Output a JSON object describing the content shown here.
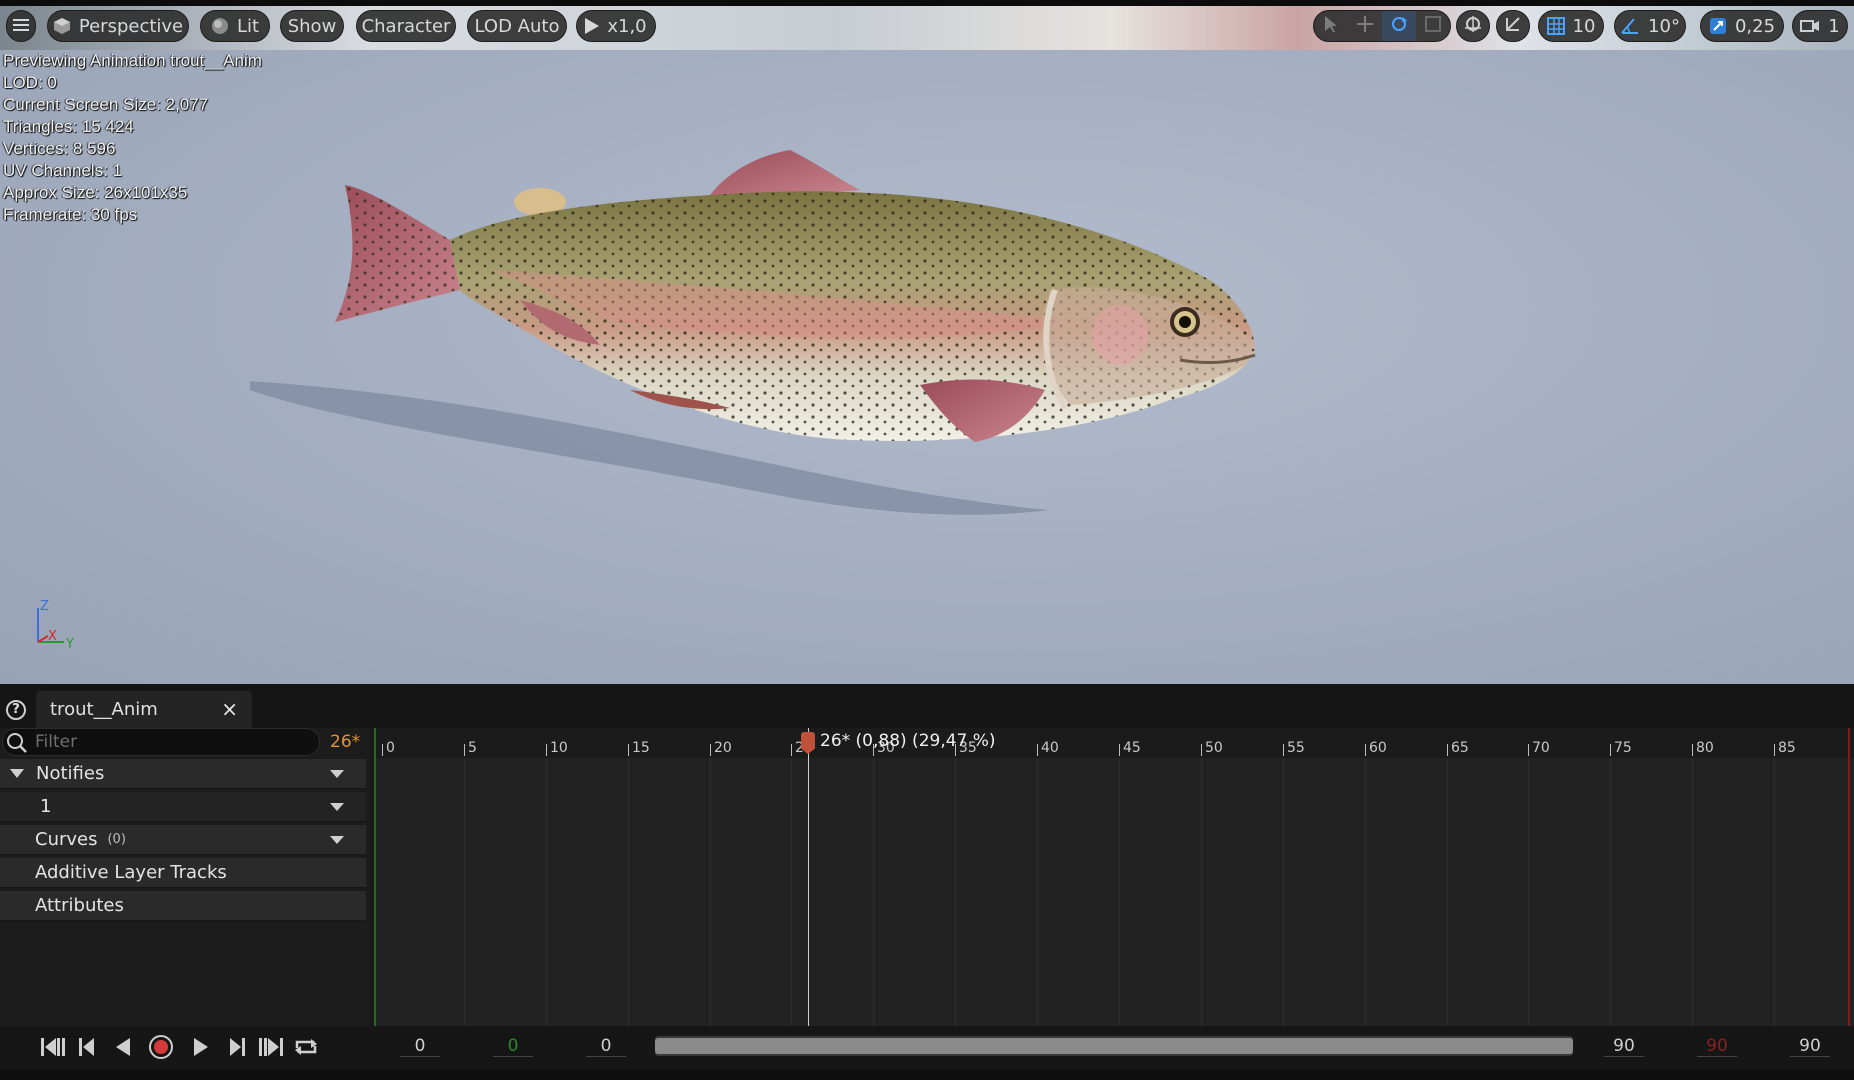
{
  "toolbar": {
    "menu_icon": "hamburger-icon",
    "perspective": "Perspective",
    "lit": "Lit",
    "show": "Show",
    "character": "Character",
    "lod": "LOD Auto",
    "play_speed": "x1,0",
    "grid_snap": "10",
    "rotation_snap": "10°",
    "scale_snap": "0,25",
    "camera_speed": "1",
    "accent_color": "#4aa3ff"
  },
  "stats": {
    "line1": "Previewing Animation trout__Anim",
    "line2": "LOD: 0",
    "line3": "Current Screen Size: 2,077",
    "line4": "Triangles: 15 424",
    "line5": "Vertices: 8 596",
    "line6": "UV Channels: 1",
    "line7": "Approx Size: 26x101x35",
    "line8": "Framerate: 30 fps"
  },
  "axis": {
    "z": "Z",
    "x": "X",
    "y": "Y"
  },
  "tab": {
    "label": "trout__Anim",
    "close": "×"
  },
  "filter": {
    "placeholder": "Filter"
  },
  "current_frame_badge": "26*",
  "tracks": {
    "notifies": "Notifies",
    "notify_track": "1",
    "curves": "Curves",
    "curves_count": "(0)",
    "additive": "Additive Layer Tracks",
    "attributes": "Attributes"
  },
  "timeline": {
    "ticks": [
      "0",
      "5",
      "10",
      "15",
      "20",
      "25",
      "30",
      "35",
      "40",
      "45",
      "50",
      "55",
      "60",
      "65",
      "70",
      "75",
      "80",
      "85"
    ],
    "scrubber_label": "26* (0,88) (29,47 %)",
    "playhead_frame": 26,
    "total_frames": 90,
    "playhead_color": "#c0513a"
  },
  "transport": {
    "view_start": "0",
    "play_start": "0",
    "start_value": "0",
    "end_value": "90",
    "play_end": "90",
    "view_end": "90",
    "play_start_color": "#2a8a2a",
    "play_end_color": "#8a2020"
  }
}
